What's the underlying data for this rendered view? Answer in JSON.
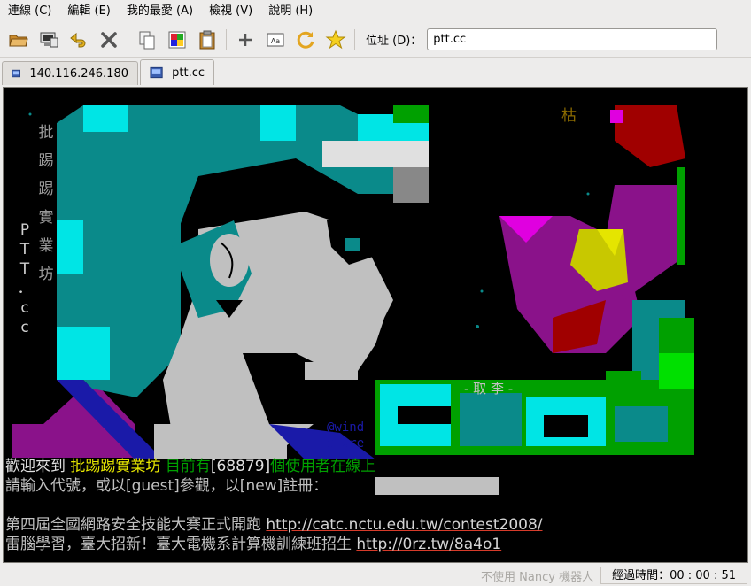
{
  "menubar": {
    "items": [
      "連線 (C)",
      "編輯 (E)",
      "我的最愛 (A)",
      "檢視 (V)",
      "說明 (H)"
    ]
  },
  "toolbar": {
    "icons": [
      "open-folder-icon",
      "site-manager-icon",
      "reconnect-icon",
      "disconnect-icon",
      "copy-icon",
      "color-copy-icon",
      "paste-icon",
      "add-favorite-icon",
      "ascii-art-icon",
      "refresh-icon",
      "star-icon"
    ],
    "address_label": "位址 (D)：",
    "address_value": "ptt.cc"
  },
  "tabs": [
    {
      "label": "140.116.246.180",
      "active": false
    },
    {
      "label": "ptt.cc",
      "active": true
    }
  ],
  "terminal": {
    "vertical_left": [
      "批",
      "踢",
      "踢",
      "實",
      "業",
      "坊"
    ],
    "vertical_ptt": [
      "P",
      "T",
      "T",
      "．",
      "c",
      "c"
    ],
    "corner_char": "枯",
    "sig_name": "- 取 李 -",
    "sig_author_1": "@wind",
    "sig_author_2": "azure",
    "welcome_prefix": "歡迎來到",
    "welcome_site": "批踢踢實業坊",
    "welcome_current": "目前有",
    "welcome_count": "[68879]",
    "welcome_suffix": "個使用者在線上",
    "prompt_line": "請輸入代號，或以[guest]參觀，以[new]註冊：",
    "news_line_1_text": "第四屆全國網路安全技能大賽正式開跑",
    "news_line_1_link": "http://catc.nctu.edu.tw/contest2008/",
    "news_line_2_text": "雷腦學習，臺大招新！臺大電機系計算機訓練班招生",
    "news_line_2_link": "http://0rz.tw/8a4o1"
  },
  "statusbar": {
    "hint": "不使用 Nancy 機器人",
    "elapsed": "經過時間：00 : 00 : 51"
  },
  "colors": {
    "terminal_bg": "#000000",
    "cyan": "#00e5e5",
    "teal": "#0a8a8a",
    "gray": "#c0c0c0",
    "purple": "#8a128a",
    "magenta": "#e000e0",
    "red": "#a00000",
    "green": "#00a000",
    "lime": "#00e000",
    "yellow": "#e5e500",
    "blue": "#1a1aa8",
    "link_underline": "#d63b2a"
  }
}
